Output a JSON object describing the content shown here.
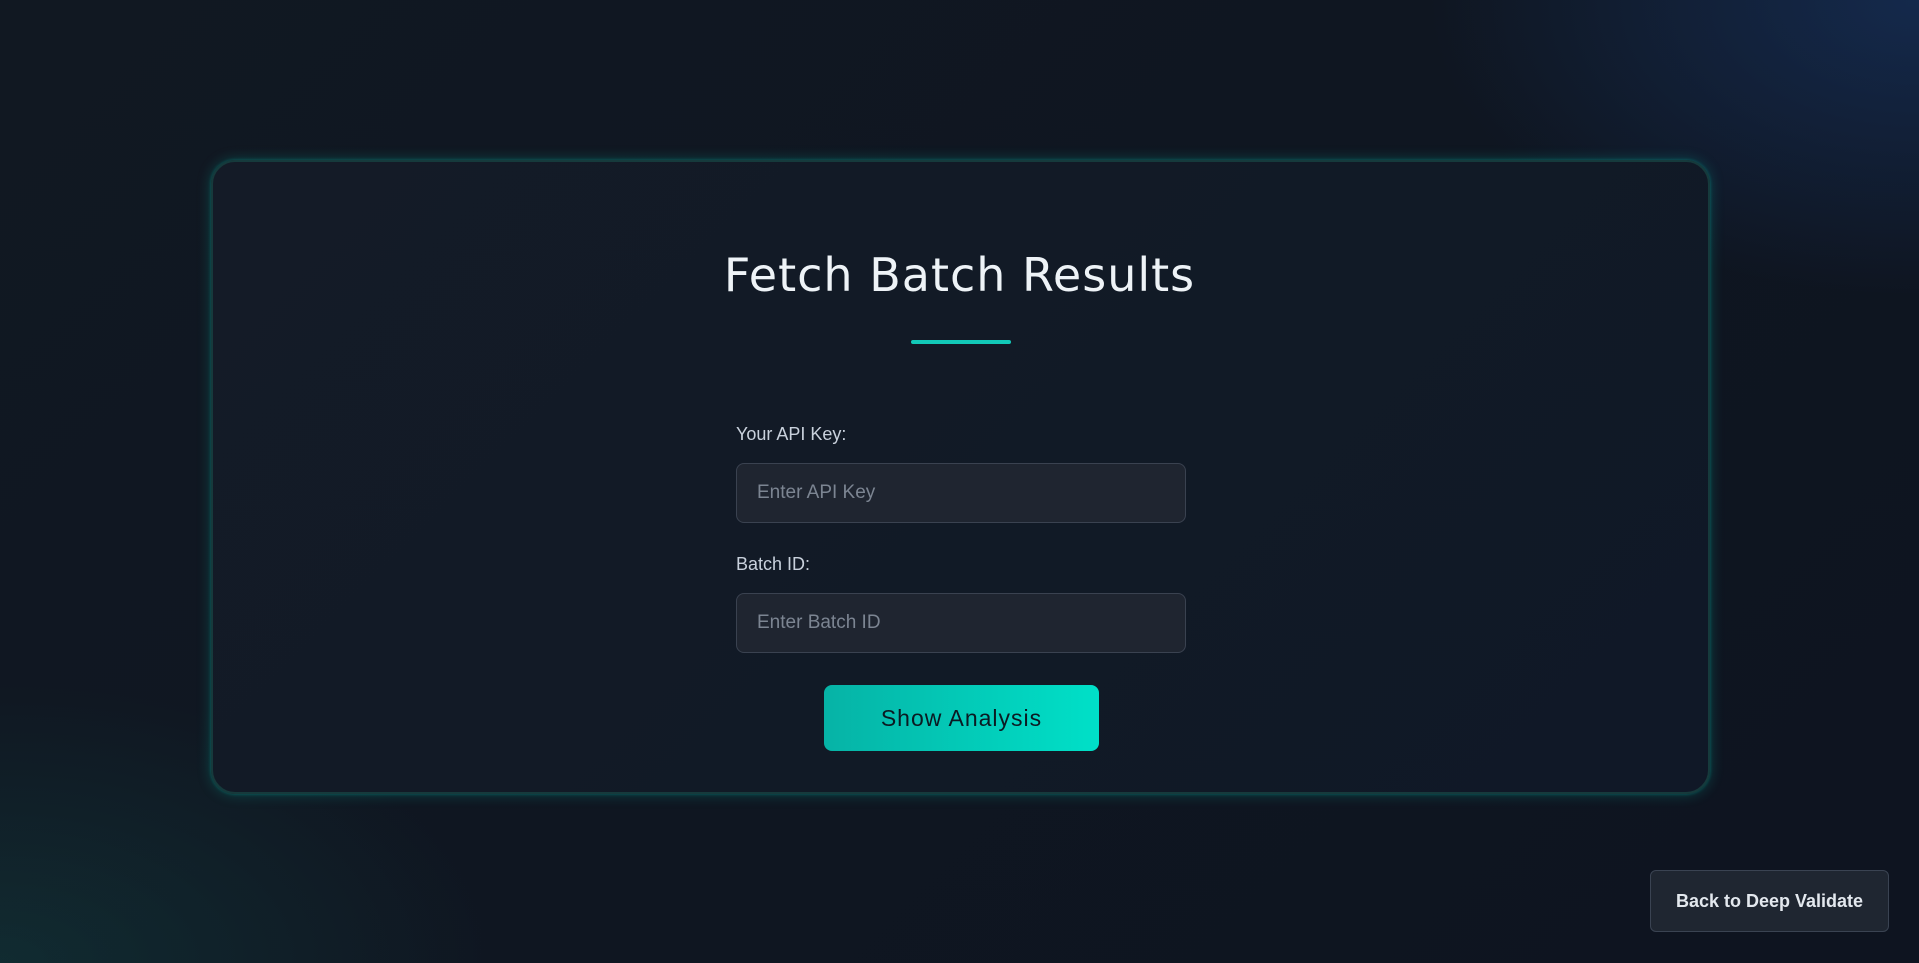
{
  "page": {
    "title": "Fetch Batch Results"
  },
  "form": {
    "api_key": {
      "label": "Your API Key:",
      "placeholder": "Enter API Key",
      "value": ""
    },
    "batch_id": {
      "label": "Batch ID:",
      "placeholder": "Enter Batch ID",
      "value": ""
    },
    "submit_label": "Show Analysis"
  },
  "footer": {
    "back_label": "Back to Deep Validate"
  },
  "colors": {
    "accent": "#12c9b8",
    "button_gradient_start": "#06b3a6",
    "button_gradient_end": "#00e0c8",
    "background": "#111822",
    "card_background": "#141b27",
    "input_background": "#1f2530"
  }
}
